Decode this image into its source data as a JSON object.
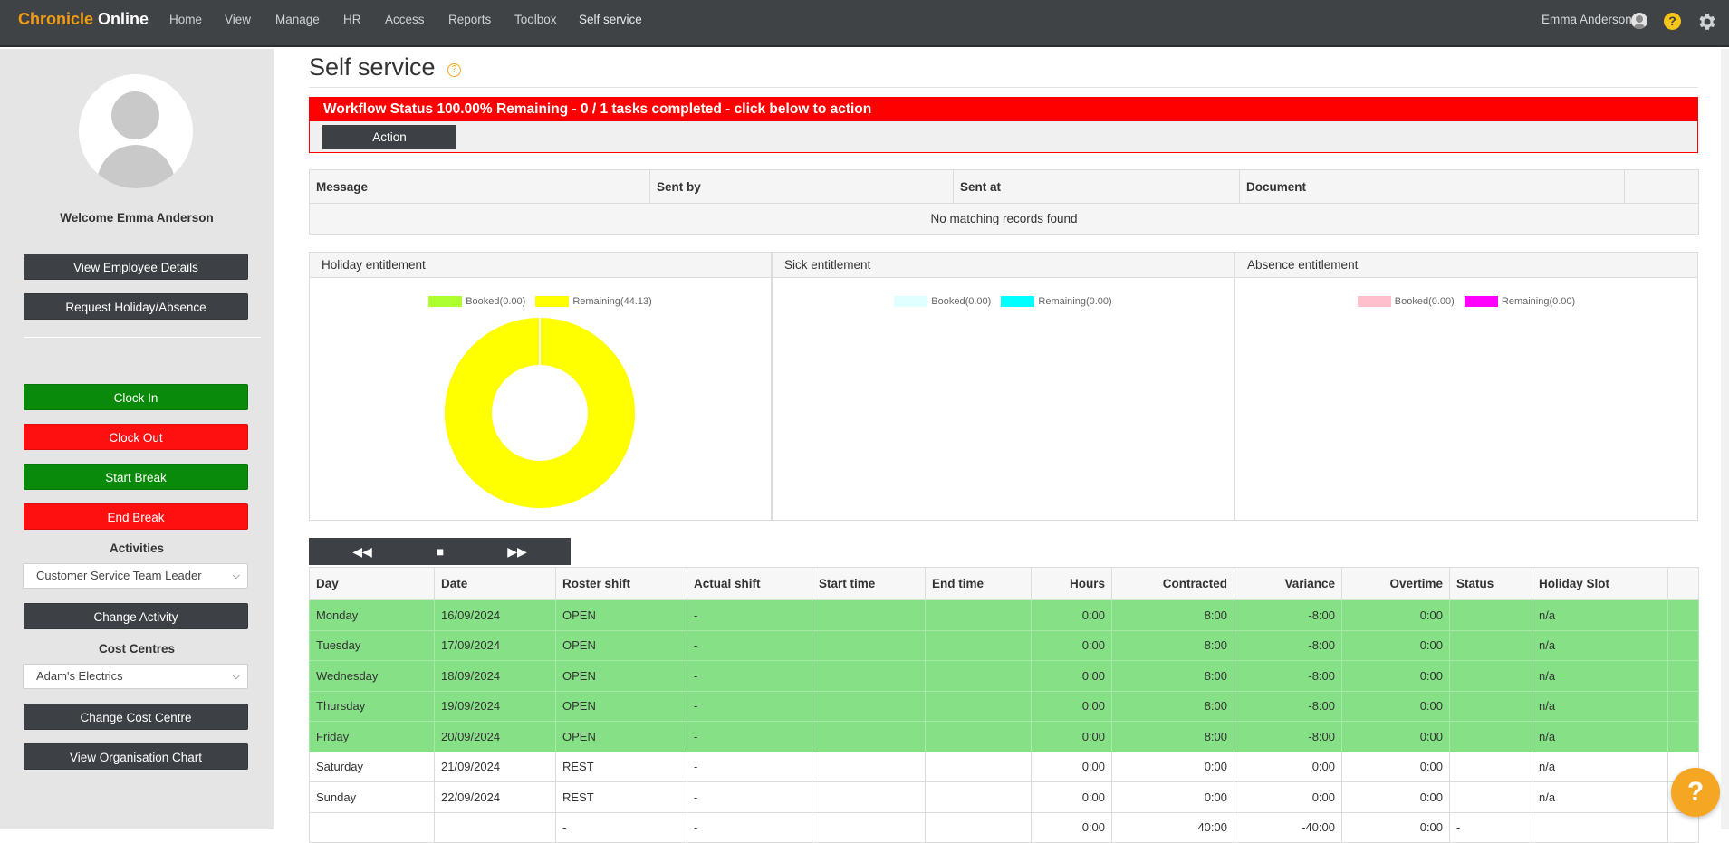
{
  "brand": {
    "part1": "Chronicle",
    "part2": " Online"
  },
  "nav": [
    "Home",
    "View",
    "Manage",
    "HR",
    "Access",
    "Reports",
    "Toolbox",
    "Self service"
  ],
  "user": {
    "name": "Emma Anderson"
  },
  "sidebar": {
    "welcome": "Welcome Emma Anderson",
    "buttons": {
      "view_details": "View Employee Details",
      "request_holiday": "Request Holiday/Absence",
      "clock_in": "Clock In",
      "clock_out": "Clock Out",
      "start_break": "Start Break",
      "end_break": "End Break",
      "change_activity": "Change Activity",
      "change_cost_centre": "Change Cost Centre",
      "view_org_chart": "View Organisation Chart"
    },
    "activities_label": "Activities",
    "activity_selected": "Customer Service Team Leader",
    "cost_centres_label": "Cost Centres",
    "cost_centre_selected": "Adam's Electrics"
  },
  "page": {
    "title": "Self service"
  },
  "workflow": {
    "status": "Workflow Status 100.00% Remaining - 0 / 1 tasks completed - click below to action",
    "action_label": "Action"
  },
  "messages": {
    "headers": [
      "Message",
      "Sent by",
      "Sent at",
      "Document",
      ""
    ],
    "empty_text": "No matching records found"
  },
  "entitlements": [
    {
      "title": "Holiday entitlement",
      "booked_label": "Booked(0.00)",
      "booked_color": "#adff2f",
      "remaining_label": "Remaining(44.13)",
      "remaining_color": "#ffff00",
      "booked": 0.0,
      "remaining": 44.13
    },
    {
      "title": "Sick entitlement",
      "booked_label": "Booked(0.00)",
      "booked_color": "#e0ffff",
      "remaining_label": "Remaining(0.00)",
      "remaining_color": "#00ffff",
      "booked": 0.0,
      "remaining": 0.0
    },
    {
      "title": "Absence entitlement",
      "booked_label": "Booked(0.00)",
      "booked_color": "#ffc0cb",
      "remaining_label": "Remaining(0.00)",
      "remaining_color": "#ff00ff",
      "booked": 0.0,
      "remaining": 0.0
    }
  ],
  "week_nav": {
    "prev": "◀◀",
    "current": "■",
    "next": "▶▶"
  },
  "roster": {
    "headers": [
      "Day",
      "Date",
      "Roster shift",
      "Actual shift",
      "Start time",
      "End time",
      "Hours",
      "Contracted",
      "Variance",
      "Overtime",
      "Status",
      "Holiday Slot",
      ""
    ],
    "rows": [
      [
        "Monday",
        "16/09/2024",
        "OPEN",
        "-",
        "",
        "",
        "0:00",
        "8:00",
        "-8:00",
        "0:00",
        "",
        "n/a",
        ""
      ],
      [
        "Tuesday",
        "17/09/2024",
        "OPEN",
        "-",
        "",
        "",
        "0:00",
        "8:00",
        "-8:00",
        "0:00",
        "",
        "n/a",
        ""
      ],
      [
        "Wednesday",
        "18/09/2024",
        "OPEN",
        "-",
        "",
        "",
        "0:00",
        "8:00",
        "-8:00",
        "0:00",
        "",
        "n/a",
        ""
      ],
      [
        "Thursday",
        "19/09/2024",
        "OPEN",
        "-",
        "",
        "",
        "0:00",
        "8:00",
        "-8:00",
        "0:00",
        "",
        "n/a",
        ""
      ],
      [
        "Friday",
        "20/09/2024",
        "OPEN",
        "-",
        "",
        "",
        "0:00",
        "8:00",
        "-8:00",
        "0:00",
        "",
        "n/a",
        ""
      ],
      [
        "Saturday",
        "21/09/2024",
        "REST",
        "-",
        "",
        "",
        "0:00",
        "0:00",
        "0:00",
        "0:00",
        "",
        "n/a",
        ""
      ],
      [
        "Sunday",
        "22/09/2024",
        "REST",
        "-",
        "",
        "",
        "0:00",
        "0:00",
        "0:00",
        "0:00",
        "",
        "n/a",
        ""
      ],
      [
        "",
        "",
        "-",
        "-",
        "",
        "",
        "0:00",
        "40:00",
        "-40:00",
        "0:00",
        "-",
        "",
        ""
      ]
    ],
    "row_types": [
      "work",
      "work",
      "work",
      "work",
      "work",
      "rest",
      "rest",
      "rest"
    ]
  },
  "chat_icon": "?"
}
